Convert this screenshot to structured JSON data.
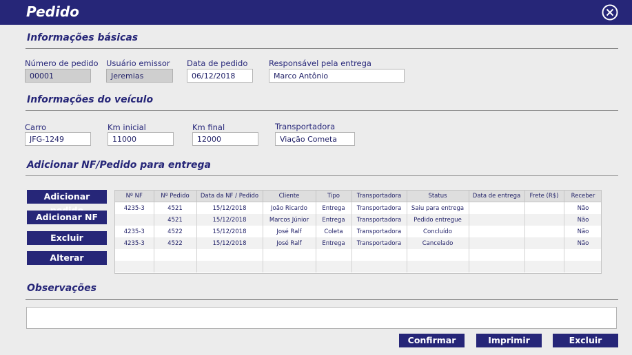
{
  "window": {
    "title": "Pedido"
  },
  "sections": {
    "basic": "Informações básicas",
    "vehicle": "Informações do veículo",
    "add": "Adicionar NF/Pedido para entrega",
    "notes": "Observações"
  },
  "basic": {
    "order_label": "Número de pedido",
    "order_value": "00001",
    "user_label": "Usuário emissor",
    "user_value": "Jeremias",
    "date_label": "Data de pedido",
    "date_value": "06/12/2018",
    "resp_label": "Responsável pela entrega",
    "resp_value": "Marco Antônio"
  },
  "vehicle": {
    "car_label": "Carro",
    "car_value": "JFG-1249",
    "km_start_label": "Km inicial",
    "km_start_value": "11000",
    "km_end_label": "Km final",
    "km_end_value": "12000",
    "carrier_label": "Transportadora",
    "carrier_value": "Viação Cometa"
  },
  "side_buttons": [
    "Adicionar pedido",
    "Adicionar NF",
    "Excluir",
    "Alterar"
  ],
  "table": {
    "columns": [
      "Nº NF",
      "Nº Pedido",
      "Data da NF / Pedido",
      "Cliente",
      "Tipo",
      "Transportadora",
      "Status",
      "Data de entrega",
      "Frete (R$)",
      "Receber"
    ],
    "rows": [
      [
        "4235-3",
        "4521",
        "15/12/2018",
        "João Ricardo",
        "Entrega",
        "Transportadora",
        "Saiu para entrega",
        "",
        "",
        "Não"
      ],
      [
        "",
        "4521",
        "15/12/2018",
        "Marcos Júnior",
        "Entrega",
        "Transportadora",
        "Pedido entregue",
        "",
        "",
        "Não"
      ],
      [
        "4235-3",
        "4522",
        "15/12/2018",
        "José Ralf",
        "Coleta",
        "Transportadora",
        "Concluído",
        "",
        "",
        "Não"
      ],
      [
        "4235-3",
        "4522",
        "15/12/2018",
        "José Ralf",
        "Entrega",
        "Transportadora",
        "Cancelado",
        "",
        "",
        "Não"
      ],
      [
        "",
        "",
        "",
        "",
        "",
        "",
        "",
        "",
        "",
        ""
      ],
      [
        "",
        "",
        "",
        "",
        "",
        "",
        "",
        "",
        "",
        ""
      ]
    ]
  },
  "footer_buttons": {
    "confirm": "Confirmar",
    "print": "Imprimir",
    "delete": "Excluir"
  },
  "colors": {
    "primary": "#262678",
    "background": "#ececec"
  },
  "icons": {
    "close": "close-circle-icon"
  }
}
